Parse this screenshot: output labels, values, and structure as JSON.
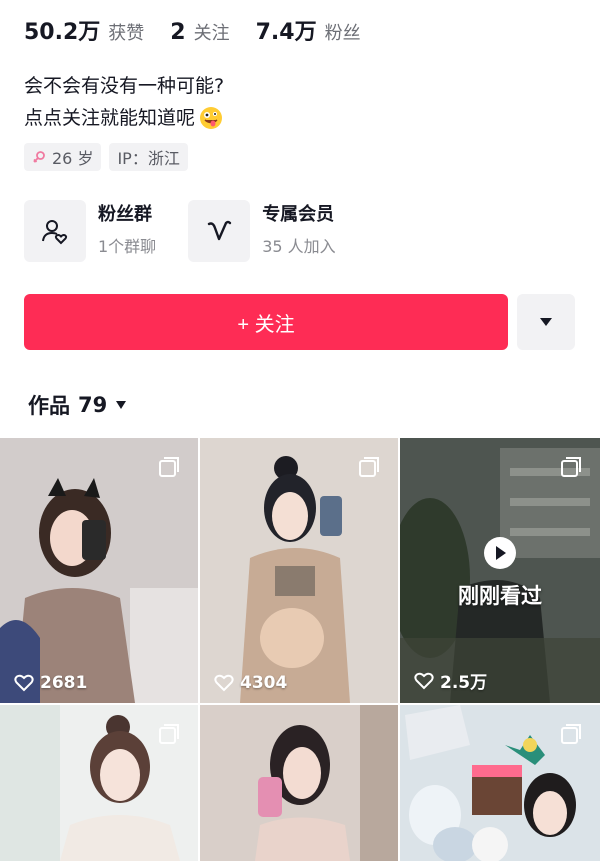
{
  "stats": [
    {
      "value": "50.2万",
      "label": "获赞"
    },
    {
      "value": "2",
      "label": "关注"
    },
    {
      "value": "7.4万",
      "label": "粉丝"
    }
  ],
  "bio": {
    "line1": "会不会有没有一种可能?",
    "line2": "点点关注就能知道呢",
    "emoji": "zany-face-emoji"
  },
  "tags": {
    "age": "26 岁",
    "ip": "IP：浙江",
    "gender_icon": "female-icon"
  },
  "cards": [
    {
      "title": "粉丝群",
      "subtitle": "1个群聊",
      "icon": "fan-group-icon"
    },
    {
      "title": "专属会员",
      "subtitle": "35 人加入",
      "icon": "membership-icon"
    }
  ],
  "actions": {
    "follow_label": "+ 关注",
    "more_icon": "dropdown-triangle-icon"
  },
  "works": {
    "label": "作品",
    "count": "79"
  },
  "tiles": [
    {
      "likes": "2681",
      "multi": true
    },
    {
      "likes": "4304",
      "multi": true
    },
    {
      "likes": "2.5万",
      "multi": true,
      "overlay": "刚刚看过"
    },
    {
      "multi": true
    },
    {
      "multi": false
    },
    {
      "multi": true
    }
  ],
  "colors": {
    "accent": "#fe2c55",
    "card_bg": "#f2f2f4",
    "secondary_text": "#6d6f76"
  }
}
